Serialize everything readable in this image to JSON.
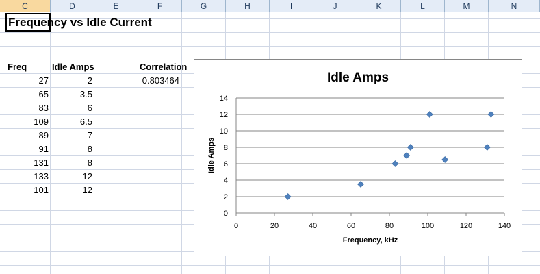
{
  "sheet": {
    "columns": [
      "C",
      "D",
      "E",
      "F",
      "G",
      "H",
      "I",
      "J",
      "K",
      "L",
      "M",
      "N"
    ],
    "selected_column": "C",
    "title": "Frequency vs Idle Current",
    "headers": {
      "freq": "Freq",
      "idle_amps": "Idle Amps",
      "correlation": "Correlation"
    },
    "correlation_value": "0.803464",
    "rows": [
      {
        "freq": "27",
        "amps": "2"
      },
      {
        "freq": "65",
        "amps": "3.5"
      },
      {
        "freq": "83",
        "amps": "6"
      },
      {
        "freq": "109",
        "amps": "6.5"
      },
      {
        "freq": "89",
        "amps": "7"
      },
      {
        "freq": "91",
        "amps": "8"
      },
      {
        "freq": "131",
        "amps": "8"
      },
      {
        "freq": "133",
        "amps": "12"
      },
      {
        "freq": "101",
        "amps": "12"
      }
    ]
  },
  "chart_data": {
    "type": "scatter",
    "title": "Idle Amps",
    "xlabel": "Frequency, kHz",
    "ylabel": "Idle Amps",
    "xlim": [
      0,
      140
    ],
    "ylim": [
      0,
      14
    ],
    "x_ticks": [
      "0",
      "20",
      "40",
      "60",
      "80",
      "100",
      "120",
      "140"
    ],
    "y_ticks": [
      "0",
      "2",
      "4",
      "6",
      "8",
      "10",
      "12",
      "14"
    ],
    "grid": "horizontal",
    "marker_color": "#4f81bd",
    "series": [
      {
        "x": [
          27,
          65,
          83,
          109,
          89,
          91,
          131,
          133,
          101
        ],
        "y": [
          2,
          3.5,
          6,
          6.5,
          7,
          8,
          8,
          12,
          12
        ]
      }
    ]
  }
}
